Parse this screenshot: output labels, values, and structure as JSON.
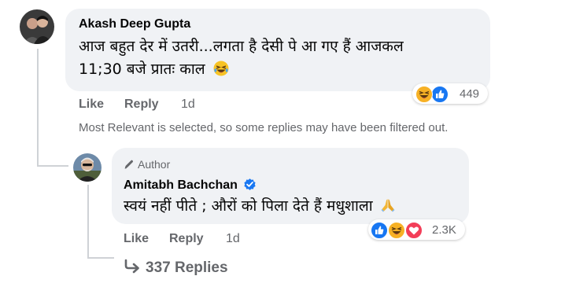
{
  "comment": {
    "author": "Akash Deep Gupta",
    "text_line1": "आज बहुत देर में उतरी...लगता है देसी पे आ गए हैं आजकल",
    "text_line2": "11;30 बजे प्रातः काल",
    "emoji": "laughing-emoji",
    "actions": {
      "like": "Like",
      "reply": "Reply",
      "time": "1d"
    },
    "reaction_icons": [
      "haha-icon",
      "like-icon"
    ],
    "reaction_count": "449"
  },
  "filter_note": "Most Relevant is selected, so some replies may have been filtered out.",
  "reply": {
    "badge": "Author",
    "badge_icon": "pencil-icon",
    "author": "Amitabh Bachchan",
    "verified_icon": "verified-badge-icon",
    "text": "स्वयं नहीं पीते ; औरों को पिला देते हैं मधुशाला",
    "emoji": "folded-hands-emoji",
    "actions": {
      "like": "Like",
      "reply": "Reply",
      "time": "1d"
    },
    "reaction_icons": [
      "like-icon",
      "haha-icon",
      "love-icon"
    ],
    "reaction_count": "2.3K"
  },
  "replies_link": {
    "icon": "reply-arrow-icon",
    "label": "337 Replies"
  },
  "colors": {
    "bubble": "#f0f2f5",
    "secondary_text": "#65676b",
    "like_blue": "#1877f2",
    "haha_yellow": "#f7b125",
    "love_red": "#f33e58"
  }
}
